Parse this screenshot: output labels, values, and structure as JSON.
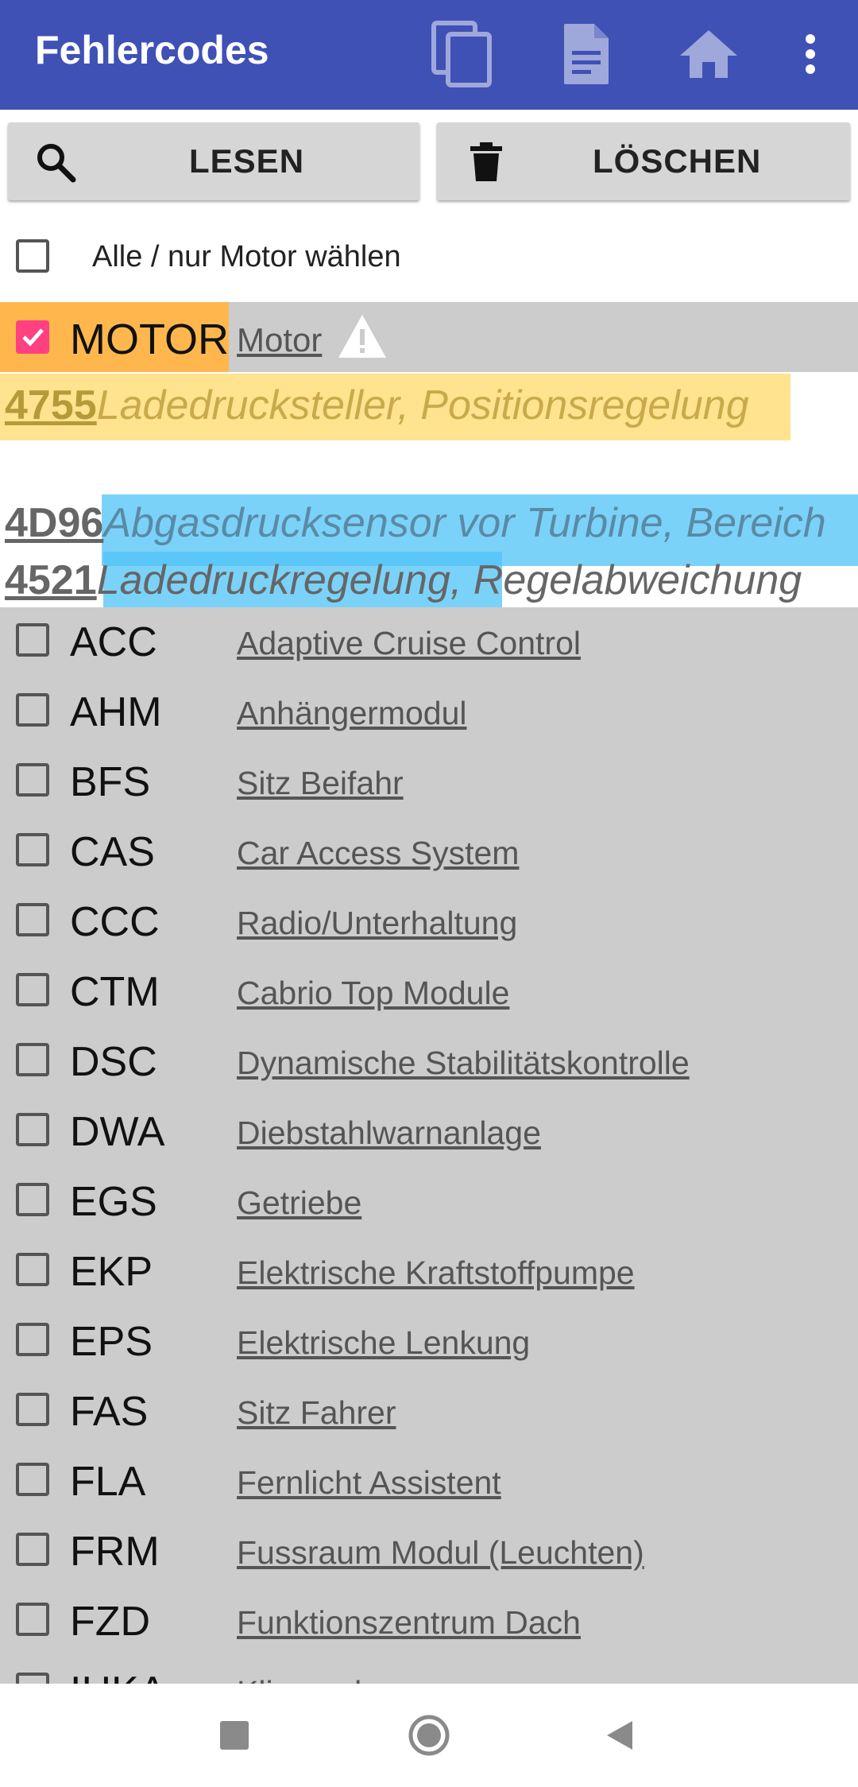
{
  "appbar": {
    "title": "Fehlercodes",
    "icons": [
      "copy-icon",
      "document-icon",
      "home-icon",
      "more-vert-icon"
    ],
    "color": "#3f51b5"
  },
  "toolbar": {
    "read_label": "LESEN",
    "delete_label": "LÖSCHEN"
  },
  "select_all": {
    "label": "Alle / nur Motor wählen",
    "checked": false
  },
  "motor": {
    "code": "MOTOR",
    "name": "Motor",
    "checked": true,
    "errors": [
      {
        "code": "4755",
        "text": "Ladedrucksteller, Positionsregelung"
      },
      {
        "code": "4D96",
        "text": "Abgasdrucksensor vor Turbine, Bereich"
      },
      {
        "code": "4521",
        "text": "Ladedruckregelung, Regelabweichung"
      }
    ]
  },
  "modules": [
    {
      "code": "ACC",
      "name": "Adaptive Cruise Control"
    },
    {
      "code": "AHM",
      "name": "Anhängermodul"
    },
    {
      "code": "BFS",
      "name": "Sitz Beifahr"
    },
    {
      "code": "CAS",
      "name": "Car Access System"
    },
    {
      "code": "CCC",
      "name": "Radio/Unterhaltung"
    },
    {
      "code": "CTM",
      "name": "Cabrio Top Module"
    },
    {
      "code": "DSC",
      "name": "Dynamische Stabilitätskontrolle"
    },
    {
      "code": "DWA",
      "name": "Diebstahlwarnanlage"
    },
    {
      "code": "EGS",
      "name": "Getriebe"
    },
    {
      "code": "EKP",
      "name": "Elektrische Kraftstoffpumpe"
    },
    {
      "code": "EPS",
      "name": "Elektrische Lenkung"
    },
    {
      "code": "FAS",
      "name": "Sitz Fahrer"
    },
    {
      "code": "FLA",
      "name": "Fernlicht Assistent"
    },
    {
      "code": "FRM",
      "name": "Fussraum Modul (Leuchten)"
    },
    {
      "code": "FZD",
      "name": "Funktionszentrum Dach"
    },
    {
      "code": "IHKA",
      "name": "Klimaanlage"
    }
  ],
  "navbar": {
    "icons": [
      "recents-icon",
      "home-nav-icon",
      "back-icon"
    ]
  }
}
